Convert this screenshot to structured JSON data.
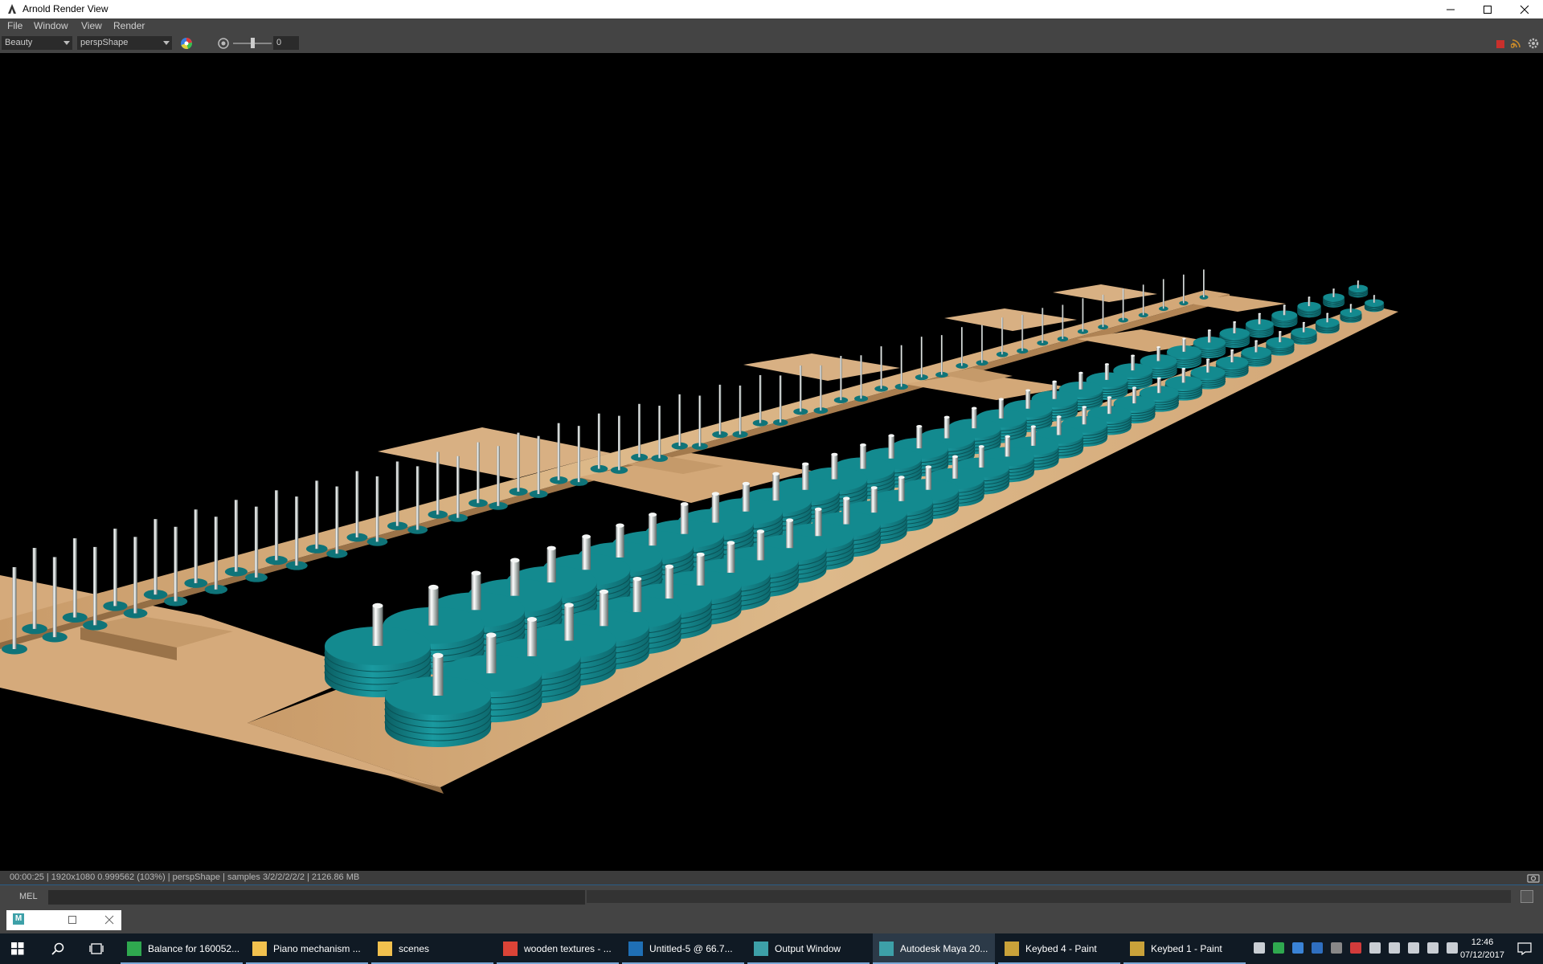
{
  "window": {
    "title": "Arnold Render View"
  },
  "menubar": {
    "items": [
      "File",
      "Window",
      "View",
      "Render"
    ]
  },
  "toolbar": {
    "aov_value": "Beauty",
    "camera_value": "perspShape",
    "exposure_value": "0",
    "exposure_level": 0.5
  },
  "statusbar": {
    "text": "00:00:25 | 1920x1080 0.999562 (103%) | perspShape | samples 3/2/2/2/2/2 | 2126.86 MB"
  },
  "mel": {
    "label": "MEL"
  },
  "taskbar": {
    "items": [
      {
        "label": "Balance for 160052...",
        "icon": "green-leaf-icon",
        "color": "#2fa84f"
      },
      {
        "label": "Piano mechanism ...",
        "icon": "folder-icon",
        "color": "#f2c14e"
      },
      {
        "label": "scenes",
        "icon": "folder-icon",
        "color": "#f2c14e"
      },
      {
        "label": "wooden textures - ...",
        "icon": "chrome-icon",
        "color": "#db4437"
      },
      {
        "label": "Untitled-5 @ 66.7...",
        "icon": "photoshop-icon",
        "color": "#1f6fb5"
      },
      {
        "label": "Output Window",
        "icon": "maya-icon",
        "color": "#3da0a8"
      },
      {
        "label": "Autodesk Maya 20...",
        "icon": "maya-icon",
        "color": "#3da0a8"
      },
      {
        "label": "Keybed 4 - Paint",
        "icon": "paint-icon",
        "color": "#c9a23a"
      },
      {
        "label": "Keybed 1 - Paint",
        "icon": "paint-icon",
        "color": "#c9a23a"
      }
    ],
    "clock_time": "12:46",
    "clock_date": "07/12/2017"
  },
  "colors": {
    "wood": "#d7b184",
    "teal": "#157f84",
    "chrome": "#e8ece9",
    "ui_dark": "#444444",
    "taskbar": "#101a24"
  }
}
